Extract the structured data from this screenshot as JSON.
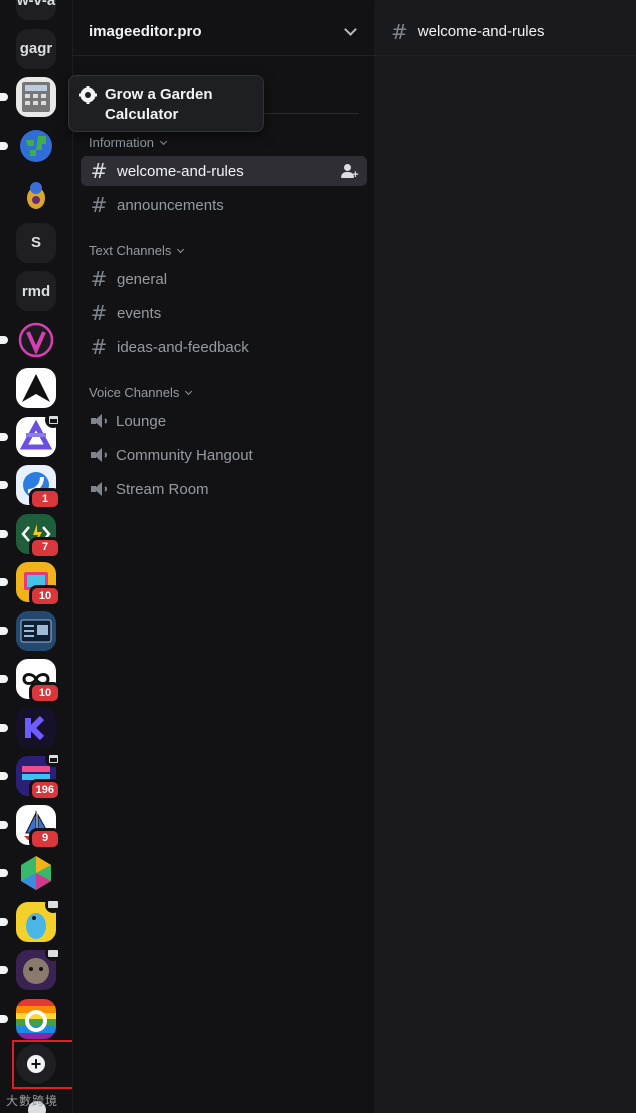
{
  "servers": [
    {
      "name": "server-wva",
      "label": "w-v-a",
      "kind": "text",
      "pip": false
    },
    {
      "name": "server-gagr",
      "label": "gagr",
      "kind": "text",
      "pip": false
    },
    {
      "name": "server-calculator",
      "label": "",
      "kind": "img",
      "img": "calculator",
      "pip": true
    },
    {
      "name": "server-earth",
      "label": "",
      "kind": "img",
      "img": "earth",
      "pip": true
    },
    {
      "name": "server-bug",
      "label": "",
      "kind": "img",
      "img": "bug",
      "pip": false
    },
    {
      "name": "server-s",
      "label": "S",
      "kind": "text",
      "pip": false
    },
    {
      "name": "server-rmd",
      "label": "rmd",
      "kind": "text",
      "pip": false
    },
    {
      "name": "server-v",
      "label": "",
      "kind": "img",
      "img": "v",
      "pip": true
    },
    {
      "name": "server-arrow",
      "label": "",
      "kind": "img",
      "img": "arrow",
      "pip": false
    },
    {
      "name": "server-purple",
      "label": "",
      "kind": "img",
      "img": "purple",
      "pip": true,
      "cal": true
    },
    {
      "name": "server-blue-swirl",
      "label": "",
      "kind": "img",
      "img": "swirl",
      "pip": true,
      "badge": "1"
    },
    {
      "name": "server-code",
      "label": "",
      "kind": "img",
      "img": "code",
      "pip": true,
      "badge": "7"
    },
    {
      "name": "server-tv",
      "label": "",
      "kind": "img",
      "img": "tv",
      "pip": true,
      "badge": "10"
    },
    {
      "name": "server-window",
      "label": "",
      "kind": "img",
      "img": "window",
      "pip": true
    },
    {
      "name": "server-infinity",
      "label": "",
      "kind": "img",
      "img": "infinity",
      "pip": true,
      "badge": "10"
    },
    {
      "name": "server-k",
      "label": "",
      "kind": "img",
      "img": "k",
      "pip": true
    },
    {
      "name": "server-game",
      "label": "",
      "kind": "img",
      "img": "game",
      "pip": true,
      "cal": true,
      "badge": "196"
    },
    {
      "name": "server-sailboat",
      "label": "",
      "kind": "img",
      "img": "sail",
      "pip": true,
      "badge": "9"
    },
    {
      "name": "server-hexagon",
      "label": "",
      "kind": "img",
      "img": "hex",
      "pip": true
    },
    {
      "name": "server-bird",
      "label": "",
      "kind": "img",
      "img": "bird",
      "pip": true,
      "screen": true
    },
    {
      "name": "server-cat",
      "label": "",
      "kind": "img",
      "img": "cat",
      "pip": true,
      "screen": true
    },
    {
      "name": "server-rainbow",
      "label": "",
      "kind": "img",
      "img": "rainbow",
      "pip": true
    }
  ],
  "tooltip": {
    "line1": "Grow a Garden",
    "line2": "Calculator"
  },
  "guild": {
    "name": "imageeditor.pro"
  },
  "categories": {
    "information": "Information",
    "text": "Text Channels",
    "voice": "Voice Channels"
  },
  "channels": {
    "welcome": "welcome-and-rules",
    "announcements": "announcements",
    "general": "general",
    "events": "events",
    "ideas": "ideas-and-feedback",
    "lounge": "Lounge",
    "community": "Community Hangout",
    "stream": "Stream Room"
  },
  "header": {
    "channel": "welcome-and-rules"
  },
  "watermark": "大數跨境",
  "colors": {
    "accent": "#5865f2",
    "badge": "#da373c",
    "highlight_box": "#e0201d"
  }
}
